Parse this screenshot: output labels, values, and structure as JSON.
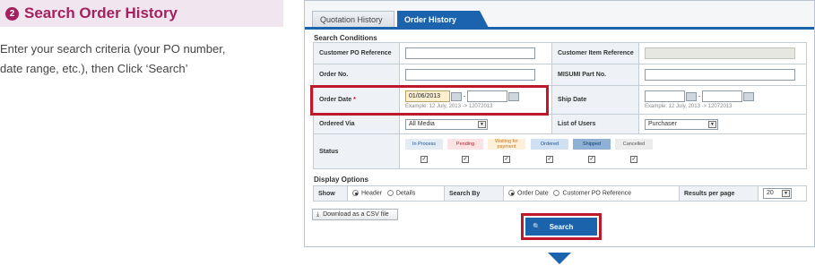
{
  "guide": {
    "step_number": "2",
    "title": "Search Order History",
    "line1": "Enter your search criteria (your PO number,",
    "line2": "date range, etc.), then Click ‘Search’"
  },
  "tabs": [
    {
      "label": "Quotation History",
      "active": false
    },
    {
      "label": "Order History",
      "active": true
    }
  ],
  "search_conditions": {
    "title": "Search Conditions",
    "customer_po_label": "Customer PO Reference",
    "customer_po_value": "",
    "customer_item_label": "Customer Item Reference",
    "customer_item_value": "",
    "order_no_label": "Order No.",
    "order_no_value": "",
    "misumi_part_label": "MISUMI Part No.",
    "misumi_part_value": "",
    "order_date_label": "Order Date",
    "required_mark": "*",
    "order_date_from": "01/06/2013",
    "order_date_to": "",
    "date_separator": "-",
    "date_example": "Example: 12 July, 2013 -> 12072013",
    "ship_date_label": "Ship Date",
    "ship_date_from": "",
    "ship_date_to": "",
    "ordered_via_label": "Ordered Via",
    "ordered_via_value": "All Media",
    "list_users_label": "List of Users",
    "list_users_value": "Purchaser",
    "status_label": "Status",
    "statuses": [
      {
        "label": "In Process",
        "checked": true,
        "color": "#e3ecf5"
      },
      {
        "label": "Pending",
        "checked": true,
        "color": "#fbe3e3"
      },
      {
        "label": "Waiting for payment",
        "checked": true,
        "color": "#fdf2d9"
      },
      {
        "label": "Ordered",
        "checked": true,
        "color": "#cfe0f2"
      },
      {
        "label": "Shipped",
        "checked": true,
        "color": "#8fb1d6"
      },
      {
        "label": "Cancelled",
        "checked": true,
        "color": "#ececec"
      }
    ],
    "check_mark": "✓"
  },
  "display_options": {
    "title": "Display Options",
    "show_label": "Show",
    "show_header": "Header",
    "show_details": "Details",
    "search_by_label": "Search By",
    "search_by_order_date": "Order Date",
    "search_by_po": "Customer PO Reference",
    "results_label": "Results per page",
    "results_value": "20"
  },
  "buttons": {
    "csv_icon": "⤓",
    "csv": "Download as a CSV file",
    "search_icon": "🔍",
    "search": "Search"
  },
  "colors": {
    "accent": "#1c63ae",
    "highlight": "#c0182b",
    "guide_title": "#a3215f"
  }
}
